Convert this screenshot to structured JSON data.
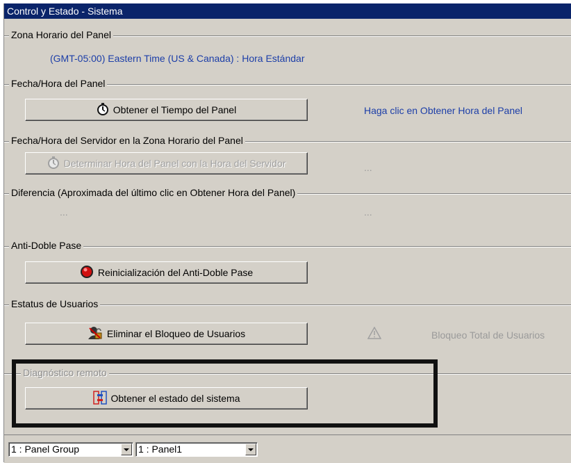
{
  "window": {
    "title": "Control y Estado - Sistema"
  },
  "timezone": {
    "label": "Zona Horario del Panel",
    "value": "(GMT-05:00) Eastern Time (US & Canada) : Hora Estándar"
  },
  "panel_time": {
    "label": "Fecha/Hora del Panel",
    "button": "Obtener el Tiempo del Panel",
    "hint": "Haga clic en Obtener Hora del Panel"
  },
  "server_time": {
    "label": "Fecha/Hora del Servidor en la Zona Horario del Panel",
    "button": "Determinar Hora del Panel con la Hora del Servidor",
    "value": "..."
  },
  "difference": {
    "label": "Diferencia (Aproximada del último clic en Obtener Hora del Panel)",
    "value_left": "...",
    "value_right": "..."
  },
  "anti_passback": {
    "label": "Anti-Doble Pase",
    "button": "Reinicialización del Anti-Doble Pase"
  },
  "user_status": {
    "label": "Estatus de Usuarios",
    "button": "Eliminar el Bloqueo de Usuarios",
    "status_text": "Bloqueo Total de Usuarios"
  },
  "remote_diag": {
    "label": "Diagnóstico remoto",
    "button": "Obtener el estado del sistema"
  },
  "statusbar": {
    "panel_group": "1 : Panel Group",
    "panel": "1 : Panel1"
  },
  "colors": {
    "titlebar": "#0a246a",
    "link_blue": "#1c3ea8",
    "face": "#d4d0c8"
  },
  "icons": {
    "panel_time": "stopwatch-icon",
    "server_time": "stopwatch-icon",
    "anti_passback": "red-button-icon",
    "user_status": "user-unlock-icon",
    "warning": "warning-triangle-icon",
    "remote_diag": "diagnostic-icon"
  }
}
